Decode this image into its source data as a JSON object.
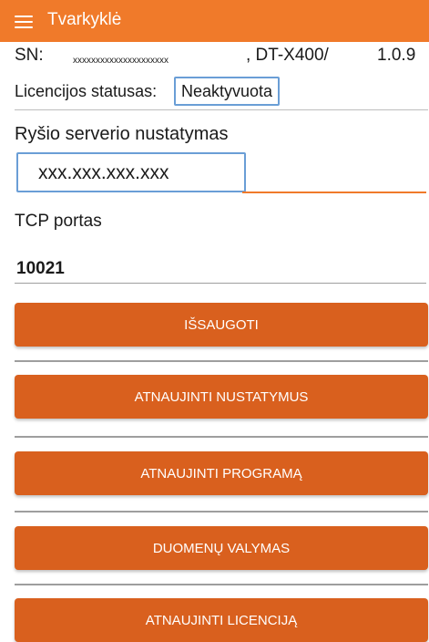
{
  "app_bar": {
    "title": "Tvarkyklė",
    "menu_icon": "hamburger-menu-icon",
    "color": "#f07a2a"
  },
  "device": {
    "sn_label": "SN:",
    "sn_value": "xxxxxxxxxxxxxxxxxxxxx",
    "model": ", DT-X400/",
    "version": "1.0.9"
  },
  "license": {
    "label": "Licencijos statusas:",
    "value": "Neaktyvuota"
  },
  "server": {
    "label": "Ryšio serverio nustatymas",
    "value": "xxx.xxx.xxx.xxx"
  },
  "tcp": {
    "label": "TCP portas",
    "value": "10021"
  },
  "buttons": [
    {
      "label": "IŠSAUGOTI"
    },
    {
      "label": "ATNAUJINTI NUSTATYMUS"
    },
    {
      "label": "ATNAUJINTI PROGRAMĄ"
    },
    {
      "label": "DUOMENŲ VALYMAS"
    },
    {
      "label": "ATNAUJINTI LICENCIJĄ"
    }
  ],
  "colors": {
    "accent": "#f07a2a",
    "button": "#d9601e",
    "highlight_box": "#6a9ed6"
  }
}
